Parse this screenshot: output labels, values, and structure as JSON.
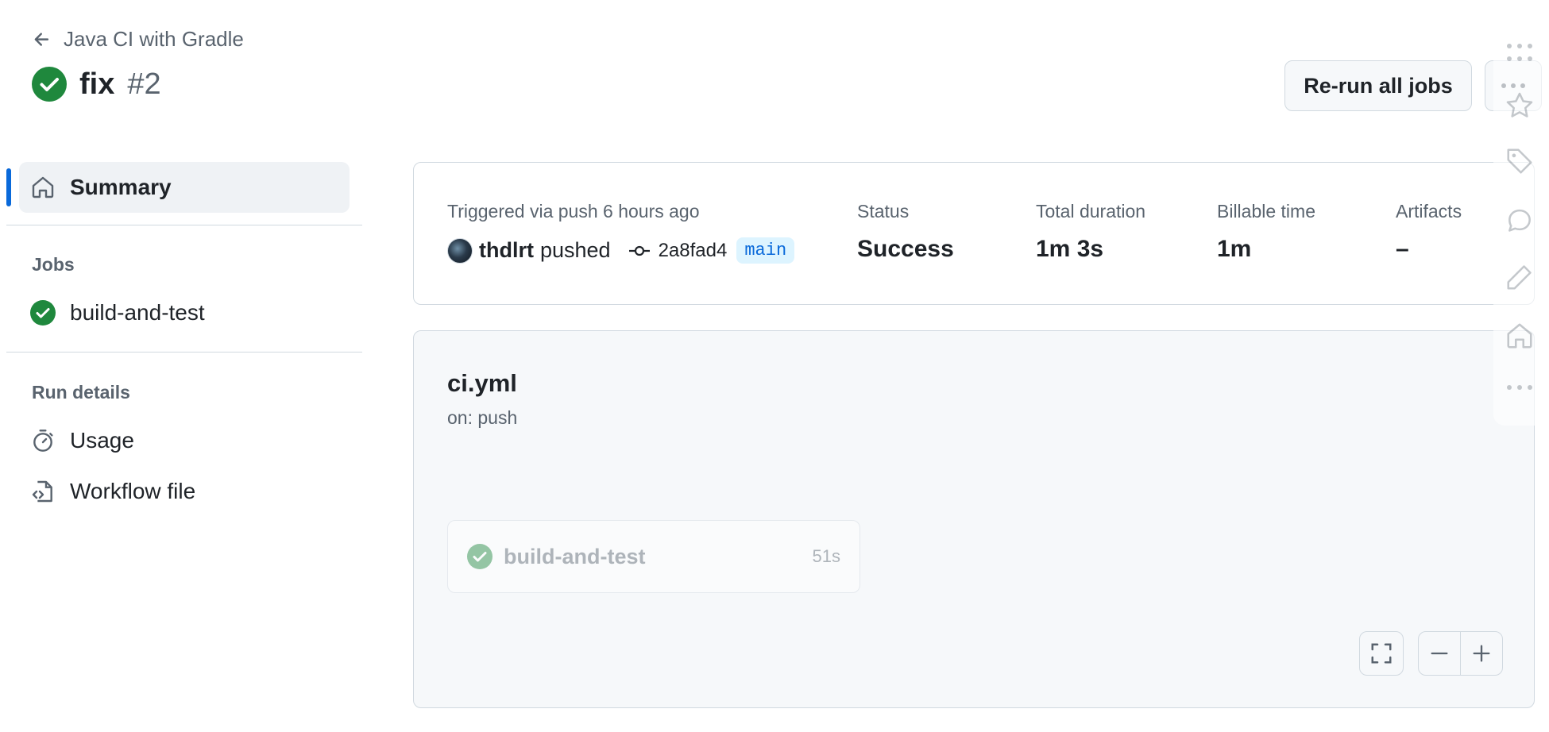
{
  "header": {
    "back_label": "Java CI with Gradle",
    "title": "fix",
    "run_number": "#2",
    "rerun_label": "Re-run all jobs"
  },
  "sidebar": {
    "summary_label": "Summary",
    "jobs_heading": "Jobs",
    "jobs": [
      {
        "label": "build-and-test",
        "status": "success"
      }
    ],
    "run_details_heading": "Run details",
    "details": [
      {
        "label": "Usage",
        "icon": "stopwatch-icon"
      },
      {
        "label": "Workflow file",
        "icon": "file-code-icon"
      }
    ]
  },
  "summary": {
    "trigger_text": "Triggered via push 6 hours ago",
    "user": "thdlrt",
    "action": "pushed",
    "commit": "2a8fad4",
    "branch": "main",
    "status_label": "Status",
    "status_value": "Success",
    "duration_label": "Total duration",
    "duration_value": "1m 3s",
    "billable_label": "Billable time",
    "billable_value": "1m",
    "artifacts_label": "Artifacts",
    "artifacts_value": "–"
  },
  "graph": {
    "workflow_file": "ci.yml",
    "trigger": "on: push",
    "job": {
      "name": "build-and-test",
      "duration": "51s"
    }
  },
  "colors": {
    "success": "#1f883d",
    "accent": "#0969da",
    "border": "#d1d9e0",
    "muted": "#59636e"
  }
}
